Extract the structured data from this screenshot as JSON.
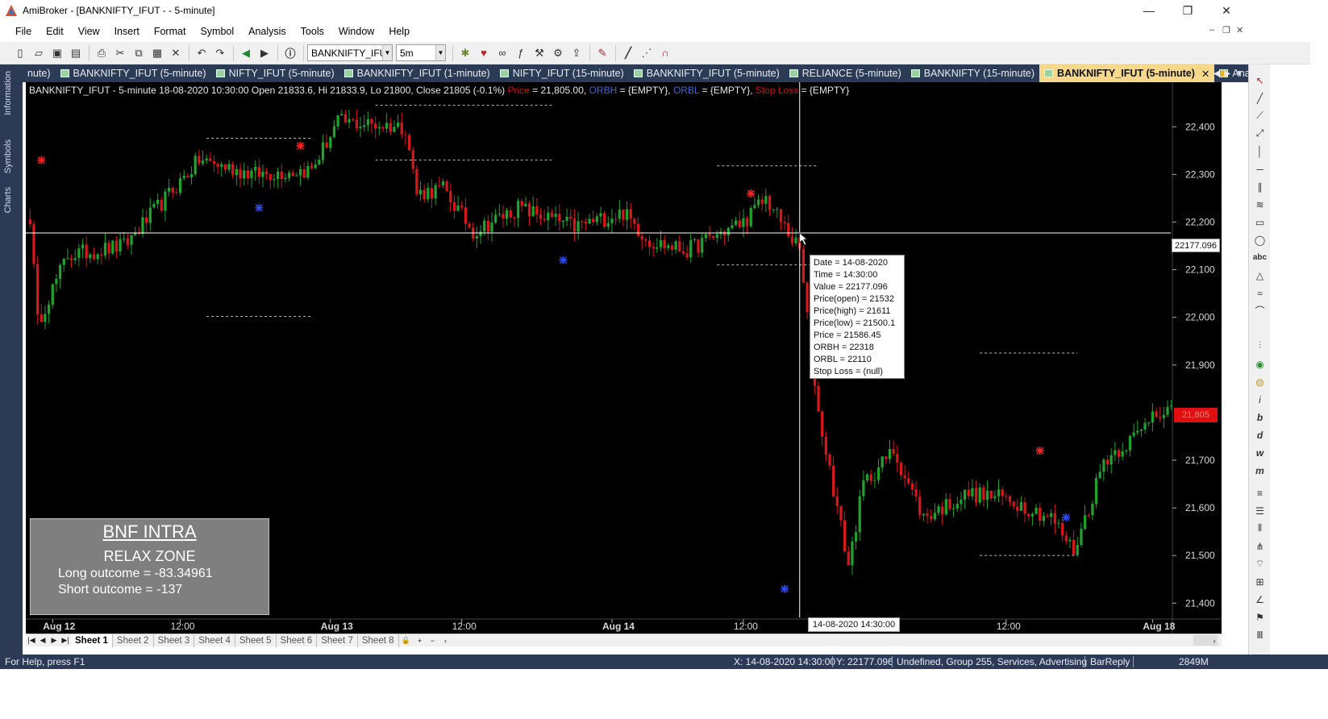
{
  "window": {
    "title": "AmiBroker - [BANKNIFTY_IFUT - - 5-minute]",
    "controls": [
      "—",
      "❐",
      "✕"
    ]
  },
  "menu": [
    "File",
    "Edit",
    "View",
    "Insert",
    "Format",
    "Symbol",
    "Analysis",
    "Tools",
    "Window",
    "Help"
  ],
  "toolbar": {
    "symbol": "BANKNIFTY_IFUT",
    "interval": "5m"
  },
  "side_tabs": [
    "Information",
    "Symbols",
    "Charts"
  ],
  "chart_tabs": [
    {
      "label": "nute)",
      "active": false,
      "icon": false
    },
    {
      "label": "BANKNIFTY_IFUT (5-minute)",
      "active": false,
      "icon": true
    },
    {
      "label": "NIFTY_IFUT (5-minute)",
      "active": false,
      "icon": true
    },
    {
      "label": "BANKNIFTY_IFUT (1-minute)",
      "active": false,
      "icon": true
    },
    {
      "label": "NIFTY_IFUT (15-minute)",
      "active": false,
      "icon": true
    },
    {
      "label": "BANKNIFTY_IFUT (5-minute)",
      "active": false,
      "icon": true
    },
    {
      "label": "RELIANCE (5-minute)",
      "active": false,
      "icon": true
    },
    {
      "label": "BANKNIFTY (15-minute)",
      "active": false,
      "icon": true
    },
    {
      "label": "BANKNIFTY_IFUT (5-minute)",
      "active": true,
      "icon": true
    },
    {
      "label": "Analysis'",
      "active": false,
      "icon": true
    }
  ],
  "chart_header": {
    "main": "BANKNIFTY_IFUT - 5-minute 18-08-2020 10:30:00 Open 21833.6, Hi 21833.9, Lo 21800, Close 21805 (-0.1%)",
    "price_label": "Price",
    "price_value": " = 21,805.00, ",
    "orbh_label": "ORBH",
    "orbh_value": " = {EMPTY}, ",
    "orbl_label": "ORBL",
    "orbl_value": " = {EMPTY}, ",
    "sl_label": "Stop Loss",
    "sl_value": " = {EMPTY}"
  },
  "tooltip": [
    "Date = 14-08-2020",
    "Time = 14:30:00",
    "Value = 22177.096",
    "Price(open) = 21532",
    "Price(high) = 21611",
    "Price(low) = 21500.1",
    "Price = 21586.45",
    "ORBH = 22318",
    "ORBL = 22110",
    "Stop Loss = (null)"
  ],
  "panel": {
    "title": "BNF INTRA",
    "zone": "RELAX ZONE",
    "long": "Long outcome = -83.34961",
    "short": "Short outcome = -137"
  },
  "cursor": {
    "date_label": "14-08-2020 14:30:00",
    "value_label": "22177.096",
    "last_price_label": "21,805"
  },
  "sheets": [
    "Sheet 1",
    "Sheet 2",
    "Sheet 3",
    "Sheet 4",
    "Sheet 5",
    "Sheet 6",
    "Sheet 7",
    "Sheet 8"
  ],
  "status": {
    "help": "For Help, press F1",
    "x": "X: 14-08-2020 14:30:00",
    "y": "Y: 22177.096",
    "info": "Undefined, Group 255, Services, Advertising",
    "source": "BarReply",
    "mem": "2849M"
  },
  "colors": {
    "up": "#1fa32b",
    "down": "#d61818",
    "crosshair": "#ffffff",
    "levels": "#bdbdbd",
    "accent_tab": "#f5d88a",
    "chrome_dark": "#2d3a56"
  },
  "chart_data": {
    "type": "candlestick",
    "symbol": "BANKNIFTY_IFUT",
    "interval": "5-minute",
    "y_ticks": [
      22400,
      22300,
      22200,
      22100,
      22000,
      21900,
      21700,
      21600,
      21500,
      21400
    ],
    "ylim": [
      21370,
      22480
    ],
    "x_ticks": [
      "Aug 12",
      "12:00",
      "Aug 13",
      "12:00",
      "Aug 14",
      "12:00",
      "12:00",
      "Aug 18"
    ],
    "x_tick_bold": [
      true,
      false,
      true,
      false,
      true,
      false,
      false,
      true
    ],
    "x_tick_bar": [
      6,
      40,
      80,
      115,
      155,
      190,
      260,
      299
    ],
    "bars_count": 305,
    "anchors": [
      [
        0,
        22210
      ],
      [
        2,
        21990
      ],
      [
        10,
        22130
      ],
      [
        25,
        22150
      ],
      [
        45,
        22330
      ],
      [
        60,
        22300
      ],
      [
        75,
        22310
      ],
      [
        82,
        22410
      ],
      [
        100,
        22400
      ],
      [
        103,
        22260
      ],
      [
        110,
        22270
      ],
      [
        118,
        22180
      ],
      [
        130,
        22230
      ],
      [
        145,
        22190
      ],
      [
        158,
        22220
      ],
      [
        165,
        22160
      ],
      [
        175,
        22140
      ],
      [
        182,
        22170
      ],
      [
        190,
        22200
      ],
      [
        196,
        22250
      ],
      [
        205,
        22140
      ],
      [
        210,
        21800
      ],
      [
        218,
        21480
      ],
      [
        222,
        21650
      ],
      [
        230,
        21720
      ],
      [
        238,
        21580
      ],
      [
        250,
        21630
      ],
      [
        260,
        21620
      ],
      [
        272,
        21580
      ],
      [
        278,
        21510
      ],
      [
        282,
        21600
      ],
      [
        286,
        21700
      ],
      [
        296,
        21760
      ],
      [
        299,
        21805
      ]
    ],
    "levels": [
      {
        "bar_from": 47,
        "bar_to": 75,
        "value": 22376
      },
      {
        "bar_from": 47,
        "bar_to": 75,
        "value": 22002
      },
      {
        "bar_from": 92,
        "bar_to": 139,
        "value": 22445
      },
      {
        "bar_from": 92,
        "bar_to": 139,
        "value": 22330
      },
      {
        "bar_from": 183,
        "bar_to": 210,
        "value": 22318
      },
      {
        "bar_from": 183,
        "bar_to": 210,
        "value": 22110
      },
      {
        "bar_from": 253,
        "bar_to": 279,
        "value": 21925
      },
      {
        "bar_from": 253,
        "bar_to": 279,
        "value": 21500
      }
    ],
    "buy_arrows": [
      [
        61,
        22230
      ],
      [
        142,
        22120
      ],
      [
        201,
        21430
      ],
      [
        276,
        21580
      ]
    ],
    "sell_arrows": [
      [
        3,
        22330
      ],
      [
        72,
        22360
      ],
      [
        192,
        22260
      ],
      [
        269,
        21720
      ]
    ],
    "crosshair": {
      "bar": 205,
      "value": 22177.096
    }
  }
}
